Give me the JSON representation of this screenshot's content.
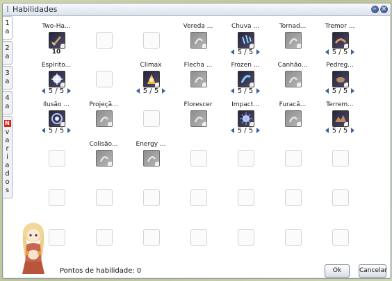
{
  "window": {
    "title": "Habilidades"
  },
  "tabs": [
    {
      "label": "1a"
    },
    {
      "label": "2a"
    },
    {
      "label": "3a"
    },
    {
      "label": "4a"
    },
    {
      "badge": "N",
      "label": "variados"
    }
  ],
  "skills": [
    {
      "name": "Two-Ha...",
      "level": "10",
      "icon": "two-hand-sword-icon",
      "state": "color",
      "arrows": false
    },
    {
      "name": "Vereda ...",
      "level": "",
      "icon": "path-icon",
      "state": "gray",
      "arrows": false
    },
    {
      "name": "Chuva ...",
      "level": "5 / 5",
      "icon": "rain-icon",
      "state": "color",
      "arrows": true
    },
    {
      "name": "Tornad...",
      "level": "",
      "icon": "tornado-icon",
      "state": "gray",
      "arrows": false
    },
    {
      "name": "Tremor ...",
      "level": "5 / 5",
      "icon": "tremor-icon",
      "state": "color",
      "arrows": true
    },
    {
      "name": "Espírito...",
      "level": "5 / 5",
      "icon": "spirit-icon",
      "state": "color",
      "arrows": true
    },
    {
      "name": "Climax",
      "level": "5 / 5",
      "icon": "climax-icon",
      "state": "color",
      "arrows": true
    },
    {
      "name": "Flecha ...",
      "level": "",
      "icon": "arrow-icon",
      "state": "gray",
      "arrows": false
    },
    {
      "name": "Frozen ...",
      "level": "5 / 5",
      "icon": "frozen-icon",
      "state": "color",
      "arrows": true
    },
    {
      "name": "Canhão...",
      "level": "",
      "icon": "cannon-icon",
      "state": "gray",
      "arrows": false
    },
    {
      "name": "Pedreg...",
      "level": "5 / 5",
      "icon": "stone-icon",
      "state": "color",
      "arrows": true
    },
    {
      "name": "Ilusão ...",
      "level": "5 / 5",
      "icon": "illusion-icon",
      "state": "color",
      "arrows": true
    },
    {
      "name": "Projeçã...",
      "level": "",
      "icon": "projection-icon",
      "state": "gray",
      "arrows": false
    },
    {
      "name": "Florescer",
      "level": "",
      "icon": "bloom-icon",
      "state": "gray",
      "arrows": false
    },
    {
      "name": "Impact...",
      "level": "5 / 5",
      "icon": "impact-icon",
      "state": "color",
      "arrows": true
    },
    {
      "name": "Furacã...",
      "level": "",
      "icon": "hurricane-icon",
      "state": "gray",
      "arrows": false
    },
    {
      "name": "Terrem...",
      "level": "5 / 5",
      "icon": "earthquake-icon",
      "state": "color",
      "arrows": true
    },
    {
      "name": "Colisão...",
      "level": "",
      "icon": "collision-icon",
      "state": "gray",
      "arrows": false
    },
    {
      "name": "Energy ...",
      "level": "",
      "icon": "energy-icon",
      "state": "gray",
      "arrows": false
    }
  ],
  "footer": {
    "points_label": "Pontos de habilidade: 0",
    "ok_label": "Ok",
    "cancel_label": "Cancelar"
  },
  "colors": {
    "accent": "#3f5f9d",
    "badge": "#d7261c"
  }
}
